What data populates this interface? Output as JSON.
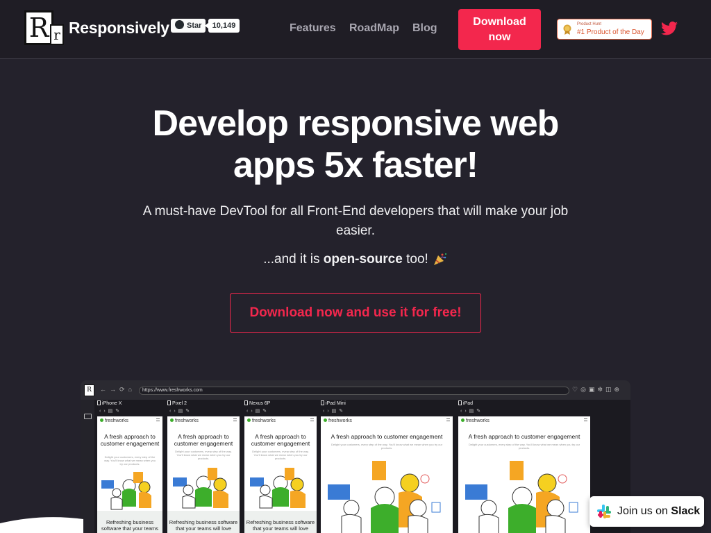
{
  "header": {
    "logo_big": "R",
    "logo_small": "r",
    "brand": "Responsively",
    "github_star_label": "Star",
    "github_star_count": "10,149",
    "nav": [
      "Features",
      "RoadMap",
      "Blog"
    ],
    "download_button_line1": "Download",
    "download_button_line2": "now",
    "producthunt_small": "Product Hunt",
    "producthunt_big": "#1 Product of the Day",
    "accent": "#f3274d"
  },
  "hero": {
    "title_line1": "Develop responsive web",
    "title_line2": "apps 5x faster!",
    "subtitle": "A must-have DevTool for all Front-End developers that will make your job easier.",
    "opensource_prefix": "...and it is ",
    "opensource_bold": "open-source",
    "opensource_suffix": " too!",
    "cta": "Download now and use it for free!"
  },
  "preview": {
    "logo": "R",
    "url": "https://www.freshworks.com",
    "devices": [
      {
        "name": "iPhone X"
      },
      {
        "name": "Pixel 2"
      },
      {
        "name": "Nexus 6P"
      },
      {
        "name": "iPad Mini"
      },
      {
        "name": "iPad"
      }
    ],
    "site_brand": "freshworks",
    "site_title_narrow": "A fresh approach to customer engagement",
    "site_title_wide": "A fresh approach to customer engagement",
    "site_desc": "Delight your customers, every step of the way. You'll know what we mean when you try our products.",
    "footer_iphone": "Refreshing business software that your teams",
    "footer_pixel": "Refreshing business software that your teams will love",
    "footer_nexus": "Refreshing business software that your teams will love"
  },
  "slack": {
    "prefix": "Join us on ",
    "bold": "Slack"
  }
}
